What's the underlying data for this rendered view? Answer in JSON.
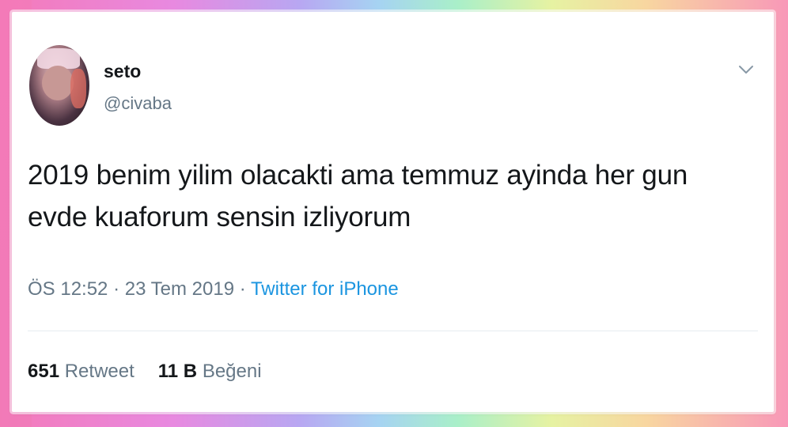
{
  "tweet": {
    "display_name": "seto",
    "handle": "@civaba",
    "text_line1": "2019 benim yilim olacakti ama temmuz ayinda her gun",
    "text_line2": "evde kuaforum sensin izliyorum",
    "time": "ÖS 12:52",
    "separator": " · ",
    "date": "23 Tem 2019",
    "source": "Twitter for iPhone",
    "retweets_count": "651",
    "retweets_label": "Retweet",
    "likes_count": "11 B",
    "likes_label": "Beğeni"
  },
  "icons": {
    "menu": "chevron-down-icon",
    "avatar": "profile-photo"
  },
  "colors": {
    "link": "#1b95e0",
    "secondary_text": "#657786",
    "primary_text": "#14171a"
  }
}
